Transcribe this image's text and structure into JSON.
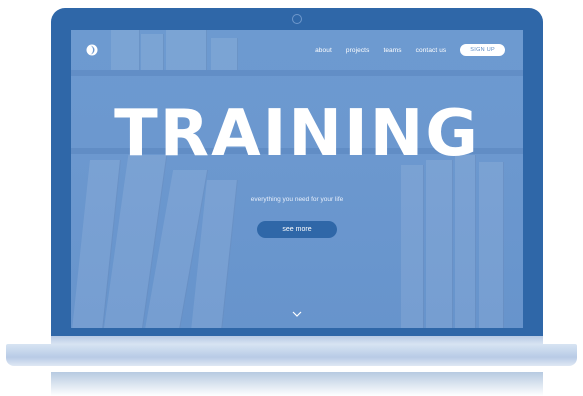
{
  "nav": {
    "items": [
      "about",
      "projects",
      "teams",
      "contact us"
    ],
    "signup_label": "SIGN UP"
  },
  "hero": {
    "title": "TRAINING",
    "subtitle": "everything you need for your life",
    "cta_label": "see more"
  },
  "icons": {
    "logo": "logo-icon",
    "scroll": "chevron-down-icon"
  },
  "colors": {
    "brand": "#2f67a8",
    "screen_bg": "#6c98cf",
    "text": "#ffffff"
  }
}
